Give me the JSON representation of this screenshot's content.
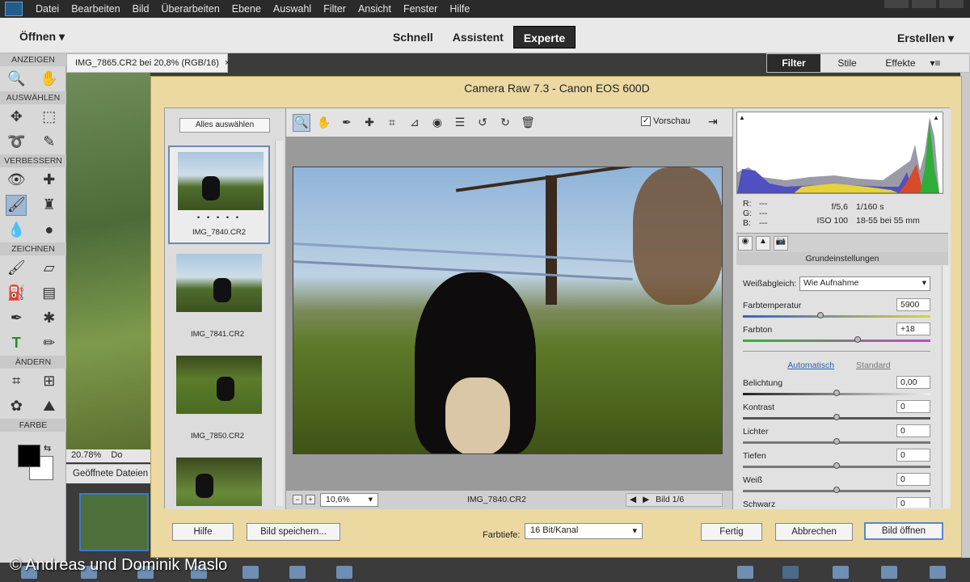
{
  "menubar": {
    "items": [
      "Datei",
      "Bearbeiten",
      "Bild",
      "Überarbeiten",
      "Ebene",
      "Auswahl",
      "Filter",
      "Ansicht",
      "Fenster",
      "Hilfe"
    ]
  },
  "modebar": {
    "open_label": "Öffnen",
    "tabs": [
      "Schnell",
      "Assistent",
      "Experte"
    ],
    "active_tab": "Experte",
    "create_label": "Erstellen"
  },
  "toolbox": {
    "sections": [
      "ANZEIGEN",
      "AUSWÄHLEN",
      "VERBESSERN",
      "ZEICHNEN",
      "ÄNDERN",
      "FARBE"
    ]
  },
  "document": {
    "tab_title": "IMG_7865.CR2 bei 20,8% (RGB/16)",
    "tab_close": "×",
    "zoom": "20.78%",
    "status_trunc": "Do",
    "open_files_label": "Geöffnete Dateien"
  },
  "right_panel": {
    "tabs": [
      "Filter",
      "Stile",
      "Effekte"
    ],
    "active_tab": "Filter"
  },
  "camera_raw": {
    "title": "Camera Raw 7.3  -  Canon EOS 600D",
    "select_all": "Alles auswählen",
    "filmstrip": [
      {
        "name": "IMG_7840.CR2",
        "rating": "• • • • •",
        "selected": true
      },
      {
        "name": "IMG_7841.CR2",
        "selected": false
      },
      {
        "name": "IMG_7850.CR2",
        "selected": false
      }
    ],
    "preview_label": "Vorschau",
    "preview_checked": "✓",
    "zoom_value": "10,6%",
    "image_name": "IMG_7840.CR2",
    "page_label": "Bild 1/6",
    "exif": {
      "r": "R:",
      "g": "G:",
      "b": "B:",
      "dash": "---",
      "aperture": "f/5,6",
      "shutter": "1/160 s",
      "iso": "ISO 100",
      "lens": "18-55 bei 55 mm"
    },
    "panel_title": "Grundeinstellungen",
    "white_balance_label": "Weißabgleich:",
    "white_balance_value": "Wie Aufnahme",
    "temperature_label": "Farbtemperatur",
    "temperature_value": "5900",
    "tint_label": "Farbton",
    "tint_value": "+18",
    "auto_label": "Automatisch",
    "default_label": "Standard",
    "sliders": [
      {
        "label": "Belichtung",
        "value": "0,00"
      },
      {
        "label": "Kontrast",
        "value": "0"
      },
      {
        "label": "Lichter",
        "value": "0"
      },
      {
        "label": "Tiefen",
        "value": "0"
      },
      {
        "label": "Weiß",
        "value": "0"
      },
      {
        "label": "Schwarz",
        "value": "0"
      }
    ],
    "buttons": {
      "help": "Hilfe",
      "save": "Bild speichern...",
      "done": "Fertig",
      "cancel": "Abbrechen",
      "open": "Bild öffnen"
    },
    "depth_label": "Farbtiefe:",
    "depth_value": "16 Bit/Kanal"
  },
  "credit": "© Andreas und Dominik Maslo",
  "colors": {
    "dialog_bg": "#ecd9a2",
    "accent_blue": "#5a88c8"
  }
}
